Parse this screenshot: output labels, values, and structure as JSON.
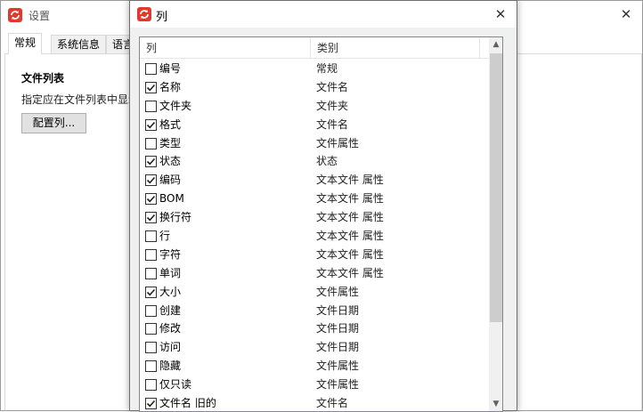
{
  "settings": {
    "title": "设置",
    "close": "✕",
    "tabs": [
      {
        "label": "常规"
      },
      {
        "label": "系统信息"
      },
      {
        "label": "语言"
      }
    ],
    "section_title": "文件列表",
    "section_desc": "指定应在文件列表中显示",
    "configure_button": "配置列..."
  },
  "dialog": {
    "title": "列",
    "close": "✕",
    "header": {
      "name": "列",
      "category": "类别"
    },
    "rows": [
      {
        "name": "编号",
        "category": "常规",
        "checked": false
      },
      {
        "name": "名称",
        "category": "文件名",
        "checked": true
      },
      {
        "name": "文件夹",
        "category": "文件夹",
        "checked": false
      },
      {
        "name": "格式",
        "category": "文件名",
        "checked": true
      },
      {
        "name": "类型",
        "category": "文件属性",
        "checked": false
      },
      {
        "name": "状态",
        "category": "状态",
        "checked": true
      },
      {
        "name": "编码",
        "category": "文本文件 属性",
        "checked": true
      },
      {
        "name": "BOM",
        "category": "文本文件 属性",
        "checked": true
      },
      {
        "name": "换行符",
        "category": "文本文件 属性",
        "checked": true
      },
      {
        "name": "行",
        "category": "文本文件 属性",
        "checked": false
      },
      {
        "name": "字符",
        "category": "文本文件 属性",
        "checked": false
      },
      {
        "name": "单词",
        "category": "文本文件 属性",
        "checked": false
      },
      {
        "name": "大小",
        "category": "文件属性",
        "checked": true
      },
      {
        "name": "创建",
        "category": "文件日期",
        "checked": false
      },
      {
        "name": "修改",
        "category": "文件日期",
        "checked": false
      },
      {
        "name": "访问",
        "category": "文件日期",
        "checked": false
      },
      {
        "name": "隐藏",
        "category": "文件属性",
        "checked": false
      },
      {
        "name": "仅只读",
        "category": "文件属性",
        "checked": false
      },
      {
        "name": "文件名 旧的",
        "category": "文件名",
        "checked": true
      }
    ]
  },
  "icons": {
    "app": "app-logo-icon",
    "check": "check-icon",
    "scroll_up": "chevron-up-icon",
    "scroll_down": "chevron-down-icon"
  },
  "colors": {
    "app_icon": "#e03a2f",
    "accent_border": "#828790"
  }
}
